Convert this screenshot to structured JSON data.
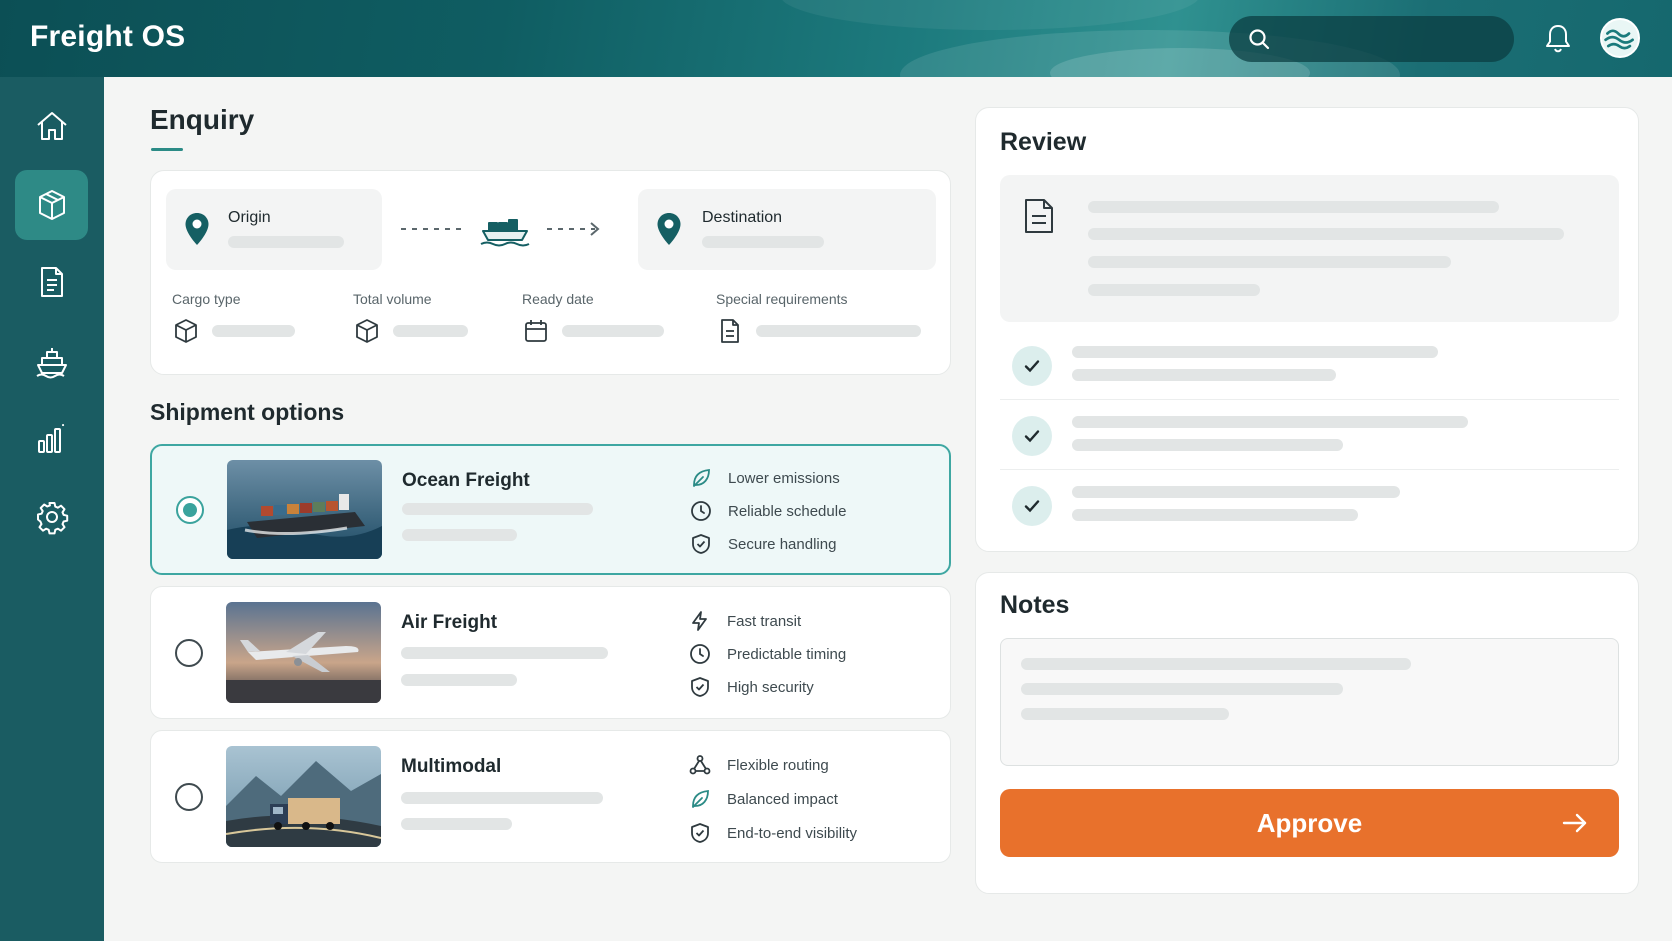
{
  "app": {
    "title": "Freight OS"
  },
  "header": {
    "search_icon": "search-icon",
    "bell_icon": "bell-icon",
    "avatar_icon": "wave-avatar"
  },
  "sidebar": {
    "items": [
      {
        "icon": "home-icon",
        "active": false
      },
      {
        "icon": "package-icon",
        "active": true
      },
      {
        "icon": "document-icon",
        "active": false
      },
      {
        "icon": "ship-icon",
        "active": false
      },
      {
        "icon": "bar-chart-icon",
        "active": false
      },
      {
        "icon": "gear-icon",
        "active": false
      }
    ]
  },
  "enquiry": {
    "title": "Enquiry",
    "origin_label": "Origin",
    "destination_label": "Destination",
    "fields": [
      {
        "label": "Cargo type",
        "icon": "box-icon"
      },
      {
        "label": "Total volume",
        "icon": "box-icon"
      },
      {
        "label": "Ready date",
        "icon": "calendar-icon"
      },
      {
        "label": "Special requirements",
        "icon": "document-icon"
      }
    ]
  },
  "shipment_options": {
    "title": "Shipment options",
    "options": [
      {
        "name": "Ocean Freight",
        "selected": true,
        "features": [
          {
            "icon": "leaf-icon",
            "label": "Lower emissions"
          },
          {
            "icon": "clock-icon",
            "label": "Reliable schedule"
          },
          {
            "icon": "shield-check-icon",
            "label": "Secure handling"
          }
        ]
      },
      {
        "name": "Air Freight",
        "selected": false,
        "features": [
          {
            "icon": "lightning-icon",
            "label": "Fast transit"
          },
          {
            "icon": "clock-icon",
            "label": "Predictable timing"
          },
          {
            "icon": "shield-check-icon",
            "label": "High security"
          }
        ]
      },
      {
        "name": "Multimodal",
        "selected": false,
        "features": [
          {
            "icon": "network-icon",
            "label": "Flexible routing"
          },
          {
            "icon": "leaf-icon",
            "label": "Balanced impact"
          },
          {
            "icon": "shield-check-icon",
            "label": "End-to-end visibility"
          }
        ]
      }
    ]
  },
  "review": {
    "title": "Review"
  },
  "notes": {
    "title": "Notes"
  },
  "actions": {
    "approve_label": "Approve"
  },
  "colors": {
    "accent": "#2b8b86",
    "sidebar": "#1a5c62",
    "approve": "#e8712c"
  }
}
